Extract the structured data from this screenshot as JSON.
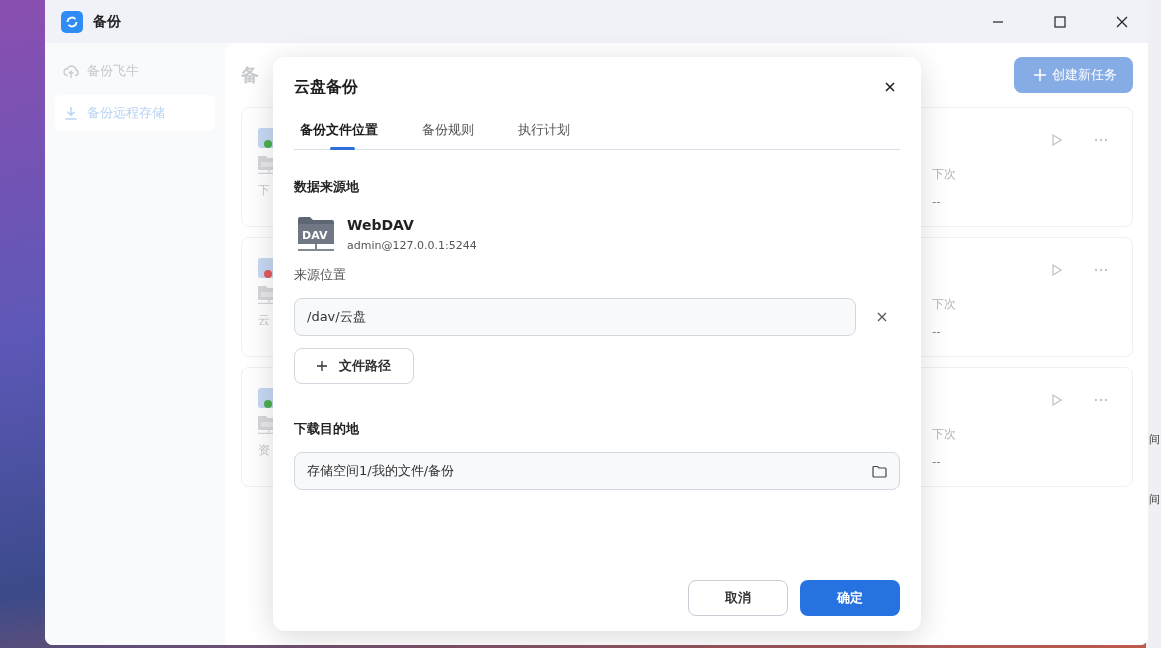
{
  "window": {
    "title": "备份"
  },
  "sidebar": {
    "items": [
      {
        "label": "备份飞牛",
        "selected": false
      },
      {
        "label": "备份远程存储",
        "selected": true
      }
    ]
  },
  "page": {
    "title": "备",
    "create_button": "创建新任务"
  },
  "tasks": [
    {
      "name": "下",
      "color": "#4caf50",
      "next_label": "下次",
      "next_value": "--"
    },
    {
      "name": "云",
      "color": "#e05a5a",
      "next_label": "下次",
      "next_value": "--"
    },
    {
      "name": "资",
      "color": "#4caf50",
      "next_label": "下次",
      "next_value": "--"
    }
  ],
  "dialog": {
    "title": "云盘备份",
    "tabs": [
      {
        "label": "备份文件位置",
        "selected": true
      },
      {
        "label": "备份规则",
        "selected": false
      },
      {
        "label": "执行计划",
        "selected": false
      }
    ],
    "source": {
      "heading": "数据来源地",
      "icon_text": "DAV",
      "name": "WebDAV",
      "address": "admin@127.0.0.1:5244",
      "location_label": "来源位置",
      "paths": [
        "/dav/云盘"
      ],
      "add_path_button": "文件路径"
    },
    "destination": {
      "heading": "下载目的地",
      "value": "存储空间1/我的文件/备份"
    },
    "buttons": [
      {
        "label": "取消",
        "kind": "secondary"
      },
      {
        "label": "确定",
        "kind": "primary"
      }
    ]
  },
  "desktop": {
    "side_texts": [
      "间",
      "间"
    ]
  }
}
